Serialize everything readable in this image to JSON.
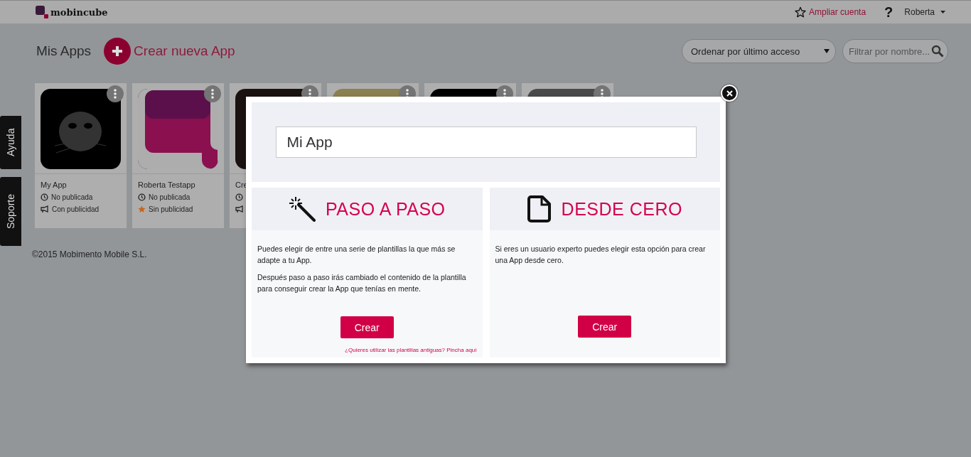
{
  "header": {
    "logo": "mobincube",
    "upgrade": "Ampliar cuenta",
    "help": "?",
    "user": "Roberta"
  },
  "toolbar": {
    "title": "Mis Apps",
    "create": "Crear nueva App",
    "sort": "Ordenar por último acceso",
    "filter_placeholder": "Filtrar por nombre..."
  },
  "side_tabs": [
    "Ayuda",
    "Soporte"
  ],
  "cards": [
    {
      "kind": "picture",
      "name": "My App",
      "status": {
        "kind": "unpublished",
        "label": "No publicada"
      },
      "publicity": {
        "kind": "ads",
        "label": "Con publicidad"
      }
    },
    {
      "kind": "picture",
      "name": "Roberta Testapp",
      "status": {
        "kind": "unpublished",
        "label": "No publicada"
      },
      "publicity": {
        "kind": "no_ads",
        "label": "Sin publicidad"
      }
    },
    {
      "kind": "picture",
      "name": "Cre",
      "status": {
        "kind": "unpublished"
      },
      "publicity": {
        "kind": "ads"
      }
    },
    {
      "kind": "picture"
    },
    {
      "kind": "picture"
    },
    {
      "kind": "picture"
    }
  ],
  "footer": "©2015 Mobimento Mobile S.L.",
  "modal": {
    "app_name": "Mi App",
    "options": [
      {
        "kind": "wizard",
        "title": "PASO A PASO",
        "paragraphs": [
          "Puedes elegir de entre una serie de plantillas la que más se adapte a tu App.",
          "Después paso a paso irás cambiado el contenido de la plantilla para conseguir crear la App que tenías en mente."
        ],
        "button": "Crear",
        "link": "¿Quieres utilizar las plantillas antiguas? Pincha aquí"
      },
      {
        "kind": "blank",
        "title": "DESDE CERO",
        "paragraphs": [
          "Si eres un usuario experto puedes elegir esta opción para crear una App desde cero."
        ],
        "button": "Crear"
      }
    ]
  }
}
